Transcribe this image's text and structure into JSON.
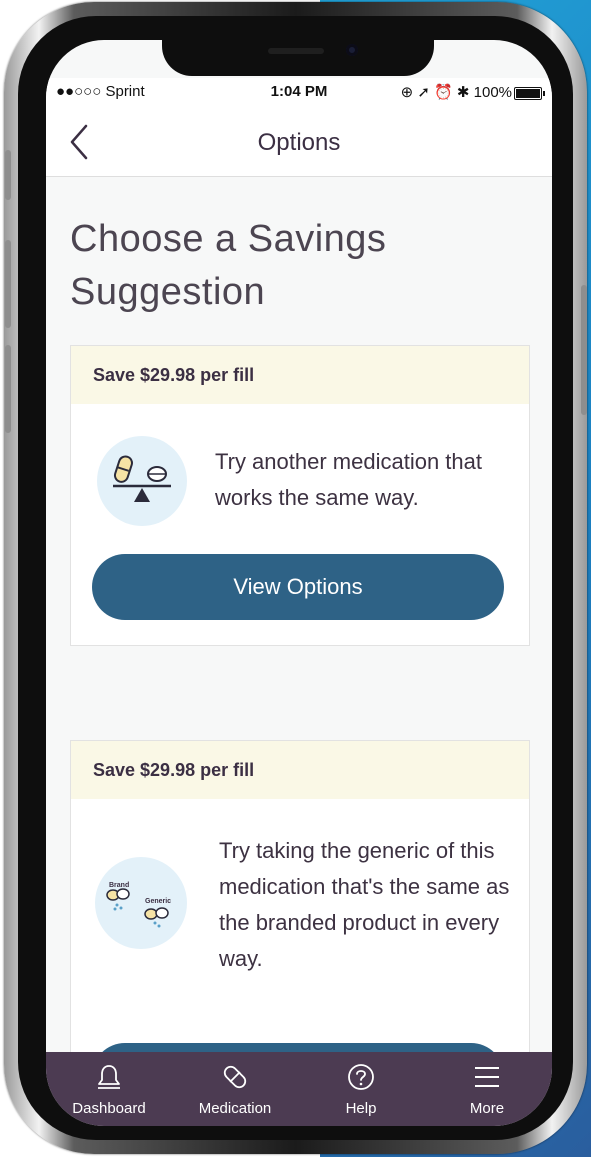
{
  "status_bar": {
    "carrier": "●●○○○ Sprint",
    "time": "1:04 PM",
    "right": "⊕ ➚ ⏰ ✱ 100%"
  },
  "nav": {
    "title": "Options"
  },
  "headline": "Choose a Savings Suggestion",
  "cards": [
    {
      "header": "Save $29.98 per fill",
      "text": "Try another medication that works the same way.",
      "button": "View Options",
      "icon": "scale-pills-icon"
    },
    {
      "header": "Save $29.98 per fill",
      "text": "Try taking the generic of this medication that's the same as the branded product in every way.",
      "icon_brand_label": "Brand",
      "icon_generic_label": "Generic",
      "icon": "brand-generic-pills-icon"
    }
  ],
  "tabs": [
    {
      "label": "Dashboard",
      "icon": "bell-icon"
    },
    {
      "label": "Medication",
      "icon": "pill-icon"
    },
    {
      "label": "Help",
      "icon": "question-circle-icon"
    },
    {
      "label": "More",
      "icon": "menu-icon"
    }
  ],
  "colors": {
    "accent_button": "#2e6286",
    "tab_bar": "#4c3b52",
    "card_header_bg": "#faf8e6"
  }
}
